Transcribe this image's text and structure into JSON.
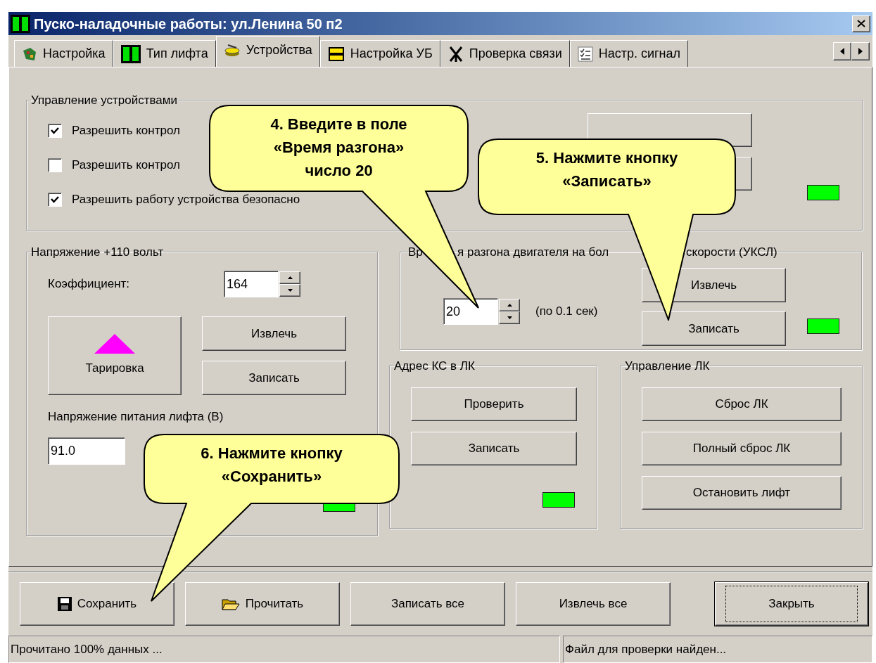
{
  "window": {
    "title": "Пуско-наладочные работы: ул.Ленина 50 п2"
  },
  "tabs": [
    {
      "label": "Настройка",
      "selected": false
    },
    {
      "label": "Тип лифта",
      "selected": false
    },
    {
      "label": "Устройства",
      "selected": true
    },
    {
      "label": "Настройка УБ",
      "selected": false
    },
    {
      "label": "Проверка связи",
      "selected": false
    },
    {
      "label": "Настр. сигнал",
      "selected": false
    }
  ],
  "protection_group": {
    "title": "Управление устройствами",
    "checkboxes": [
      {
        "label": "Разрешить контрол",
        "checked": true
      },
      {
        "label": "Разрешить контрол",
        "checked": false
      },
      {
        "label": "Разрешить работу устройства безопасно",
        "checked": true
      }
    ]
  },
  "voltage_group": {
    "title": "Напряжение +110 вольт",
    "coefficient_label": "Коэффициент:",
    "coefficient_value": "164",
    "calibrate_button": "Тарировка",
    "extract_button": "Извлечь",
    "write_button": "Записать",
    "supply_label": "Напряжение питания лифта (В)",
    "supply_value": "91.0"
  },
  "accel_group": {
    "title_parts": [
      "Вр",
      "я разгона двигателя на бол",
      "скорости (УКСЛ)"
    ],
    "value": "20",
    "unit": "(по 0.1 сек)",
    "extract_button": "Извлечь",
    "write_button": "Записать"
  },
  "address_group": {
    "title": "Адрес КС в ЛК",
    "buttons": [
      "Проверить",
      "Записать"
    ]
  },
  "lk_group": {
    "title": "Управление ЛК",
    "buttons": [
      "Сброс ЛК",
      "Полный сброс ЛК",
      "Остановить лифт"
    ]
  },
  "footer_buttons": [
    {
      "label": "Сохранить",
      "kind": "save"
    },
    {
      "label": "Прочитать",
      "kind": "open"
    },
    {
      "label": "Записать все",
      "kind": "plain"
    },
    {
      "label": "Извлечь все",
      "kind": "plain"
    },
    {
      "label": "Закрыть",
      "kind": "default"
    }
  ],
  "status_bar": [
    "Прочитано 100% данных ...",
    "Файл для проверки найден..."
  ],
  "callouts": [
    {
      "lines": [
        "4. Введите в поле",
        "«Время разгона»",
        "число 20"
      ]
    },
    {
      "lines": [
        "5. Нажмите кнопку",
        "«Записать»"
      ]
    },
    {
      "lines": [
        "6. Нажмите кнопку",
        "«Сохранить»"
      ]
    }
  ]
}
